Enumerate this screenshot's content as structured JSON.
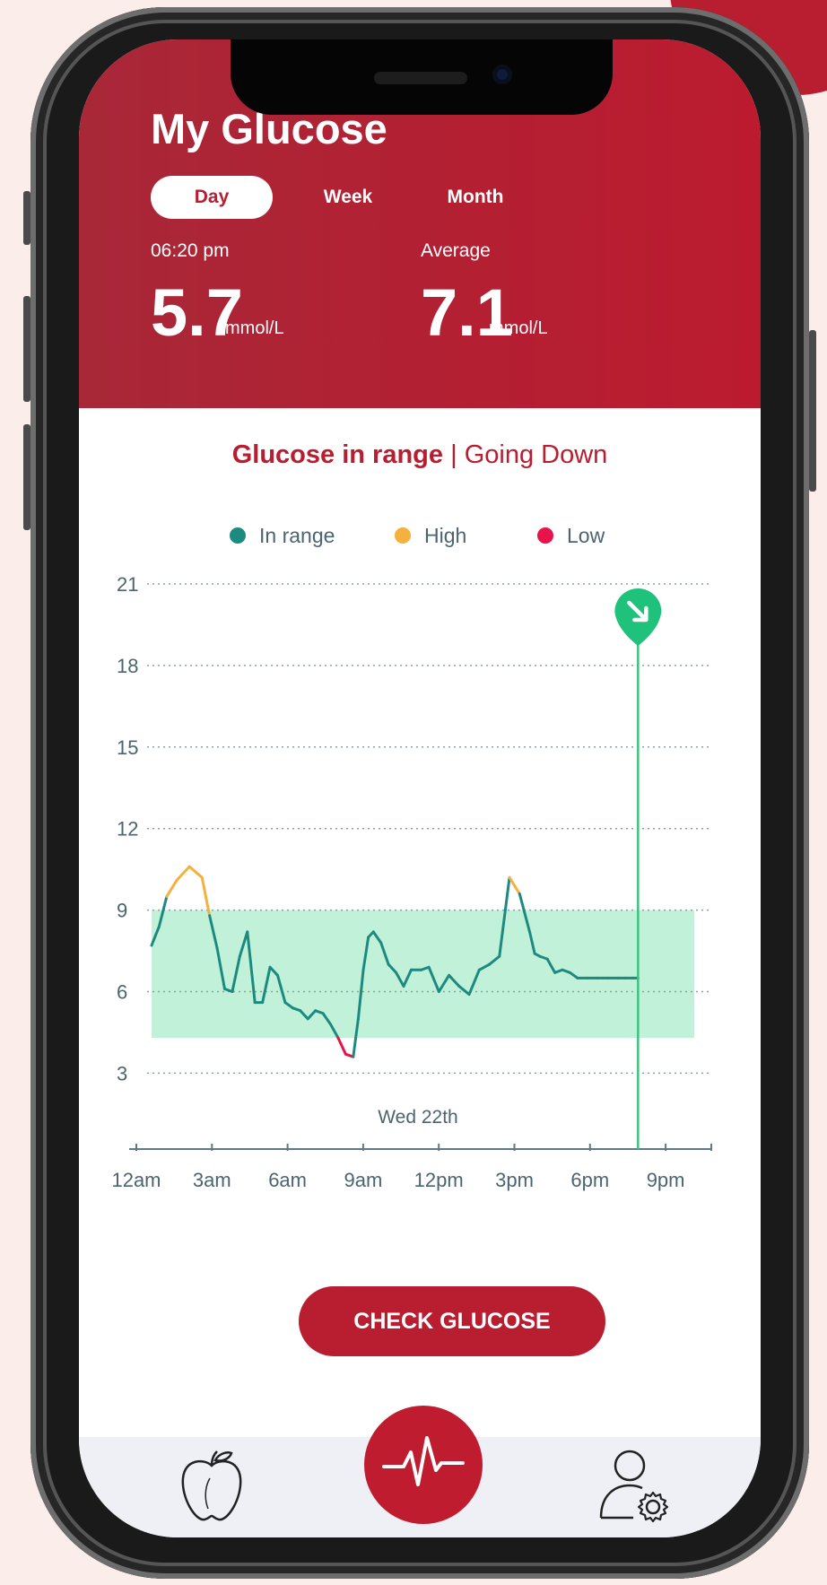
{
  "app": {
    "title": "My Glucose"
  },
  "tabs": [
    {
      "label": "Day",
      "active": true
    },
    {
      "label": "Week",
      "active": false
    },
    {
      "label": "Month",
      "active": false
    }
  ],
  "current": {
    "time": "06:20 pm",
    "value": "5.7",
    "unit": "mmol/L"
  },
  "average": {
    "label": "Average",
    "value": "7.1",
    "unit": "mmol/L"
  },
  "status": {
    "state": "Glucose in range",
    "separator": "|",
    "trend": "Going Down"
  },
  "legend": [
    {
      "label": "In range",
      "color": "#1d8a80"
    },
    {
      "label": "High",
      "color": "#f6b03d"
    },
    {
      "label": "Low",
      "color": "#e8134b"
    }
  ],
  "chart_data": {
    "type": "line",
    "date_label": "Wed 22th",
    "y_ticks": [
      "21",
      "18",
      "15",
      "12",
      "9",
      "6",
      "3"
    ],
    "x_ticks": [
      "12am",
      "3am",
      "6am",
      "9am",
      "12pm",
      "3pm",
      "6pm",
      "9pm"
    ],
    "ylim": [
      3,
      21
    ],
    "target_range": [
      4.3,
      9.0
    ],
    "current_marker_hour": 19.3,
    "series": [
      {
        "name": "glucose",
        "hours": [
          0,
          0.3,
          0.6,
          1.0,
          1.5,
          2.0,
          2.3,
          2.6,
          2.9,
          3.2,
          3.5,
          3.8,
          4.1,
          4.4,
          4.7,
          5.0,
          5.3,
          5.6,
          5.9,
          6.2,
          6.5,
          6.8,
          7.1,
          7.4,
          7.7,
          8.0,
          8.2,
          8.4,
          8.6,
          8.8,
          9.1,
          9.4,
          9.7,
          10.0,
          10.3,
          10.7,
          11.0,
          11.4,
          11.8,
          12.2,
          12.6,
          13.0,
          13.4,
          13.8,
          14.2,
          14.6,
          15.0,
          15.2,
          15.4,
          15.7,
          16.0,
          16.3,
          16.6,
          16.9,
          17.3,
          17.7,
          18.1,
          18.5,
          18.8,
          19.1,
          19.3
        ],
        "values": [
          7.7,
          8.4,
          9.5,
          10.1,
          10.6,
          10.2,
          8.8,
          7.6,
          6.1,
          6.0,
          7.3,
          8.2,
          5.6,
          5.6,
          6.9,
          6.6,
          5.6,
          5.4,
          5.3,
          5.0,
          5.3,
          5.2,
          4.8,
          4.3,
          3.7,
          3.6,
          5.0,
          6.8,
          8.0,
          8.2,
          7.8,
          7.0,
          6.7,
          6.2,
          6.8,
          6.8,
          6.9,
          6.0,
          6.6,
          6.2,
          5.9,
          6.8,
          7.0,
          7.3,
          10.2,
          9.6,
          8.2,
          7.4,
          7.3,
          7.2,
          6.7,
          6.8,
          6.7,
          6.5,
          6.5,
          6.5,
          6.5,
          6.5,
          6.5,
          6.5,
          6.5
        ]
      }
    ]
  },
  "actions": {
    "check_label": "CHECK GLUCOSE"
  },
  "nav": [
    {
      "icon": "apple-icon"
    },
    {
      "icon": "heartbeat-icon"
    },
    {
      "icon": "user-settings-icon"
    }
  ]
}
